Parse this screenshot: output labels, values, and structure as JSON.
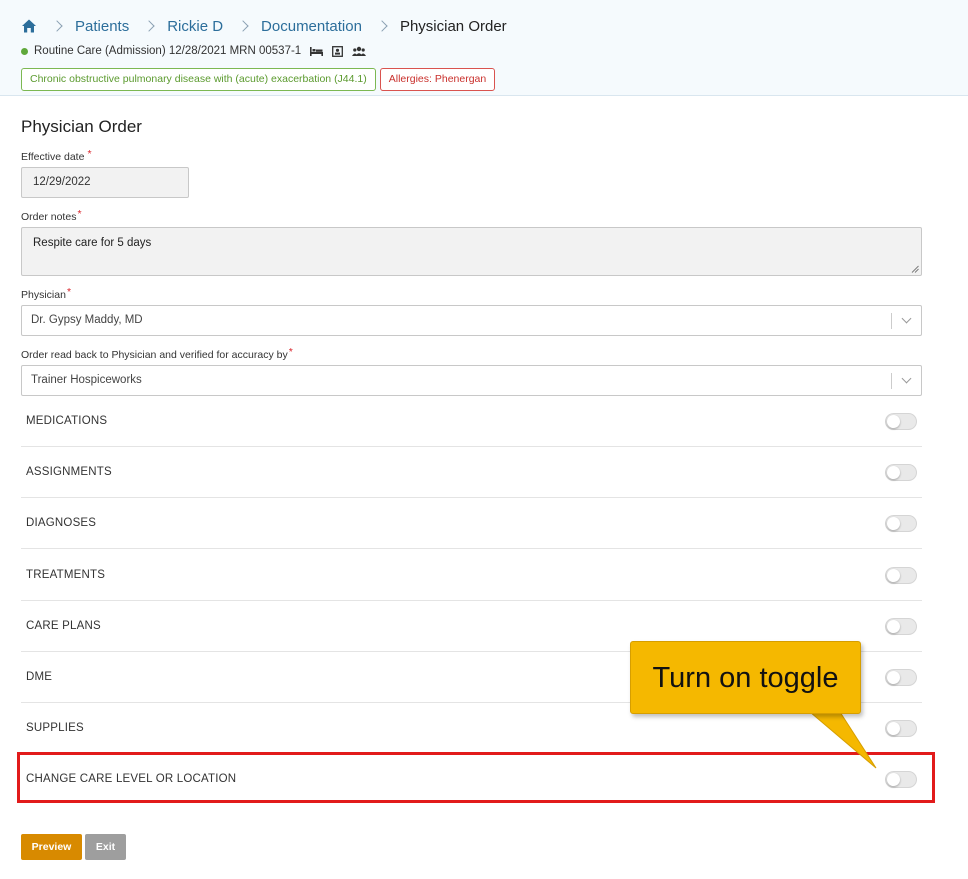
{
  "breadcrumb": {
    "items": [
      "Patients",
      "Rickie D",
      "Documentation"
    ],
    "current": "Physician Order"
  },
  "patient": {
    "status_text": "Routine Care (Admission) 12/28/2021 MRN 00537-1",
    "status_color": "#5fa83b",
    "diagnosis_tag": "Chronic obstructive pulmonary disease with (acute) exacerbation (J44.1)",
    "allergy_tag": "Allergies: Phenergan"
  },
  "form": {
    "title": "Physician Order",
    "effective_date_label": "Effective date",
    "effective_date_value": "12/29/2022",
    "order_notes_label": "Order notes",
    "order_notes_value": "Respite care for 5 days",
    "physician_label": "Physician",
    "physician_value": "Dr. Gypsy Maddy, MD",
    "verified_label": "Order read back to Physician and verified for accuracy by",
    "verified_value": "Trainer Hospiceworks",
    "required_mark": "*"
  },
  "sections": [
    {
      "label": "MEDICATIONS",
      "on": false
    },
    {
      "label": "ASSIGNMENTS",
      "on": false
    },
    {
      "label": "DIAGNOSES",
      "on": false
    },
    {
      "label": "TREATMENTS",
      "on": false
    },
    {
      "label": "CARE PLANS",
      "on": false
    },
    {
      "label": "DME",
      "on": false
    },
    {
      "label": "SUPPLIES",
      "on": false
    },
    {
      "label": "CHANGE CARE LEVEL OR LOCATION",
      "on": false
    }
  ],
  "callout": {
    "text": "Turn on toggle",
    "color": "#f5b800"
  },
  "highlight_color": "#e21b1b",
  "buttons": {
    "preview": "Preview",
    "exit": "Exit"
  },
  "icons": {
    "home": "home-icon",
    "bed": "bed-icon",
    "contact_card": "contact-card-icon",
    "people": "people-icon"
  }
}
